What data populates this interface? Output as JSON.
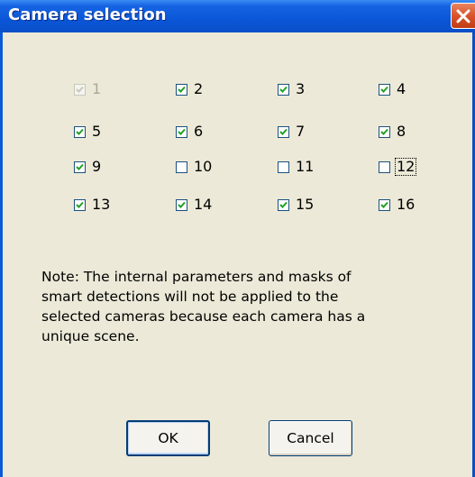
{
  "window": {
    "title": "Camera selection"
  },
  "icons": {
    "close": "close-icon",
    "check": "checkmark-icon"
  },
  "cameras": [
    {
      "label": "1",
      "checked": true,
      "disabled": true
    },
    {
      "label": "2",
      "checked": true
    },
    {
      "label": "3",
      "checked": true
    },
    {
      "label": "4",
      "checked": true
    },
    {
      "label": "5",
      "checked": true
    },
    {
      "label": "6",
      "checked": true
    },
    {
      "label": "7",
      "checked": true
    },
    {
      "label": "8",
      "checked": true
    },
    {
      "label": "9",
      "checked": true
    },
    {
      "label": "10",
      "checked": false
    },
    {
      "label": "11",
      "checked": false
    },
    {
      "label": "12",
      "checked": false,
      "focused": true
    },
    {
      "label": "13",
      "checked": true
    },
    {
      "label": "14",
      "checked": true
    },
    {
      "label": "15",
      "checked": true
    },
    {
      "label": "16",
      "checked": true
    }
  ],
  "note": "Note: The internal parameters and masks of\nsmart detections will not be applied to the\nselected cameras because each camera has a\nunique scene.",
  "buttons": {
    "ok": "OK",
    "cancel": "Cancel"
  },
  "colors": {
    "title_bar": "#0a56d8",
    "client_bg": "#ece9d8",
    "close_button": "#d9542c"
  }
}
